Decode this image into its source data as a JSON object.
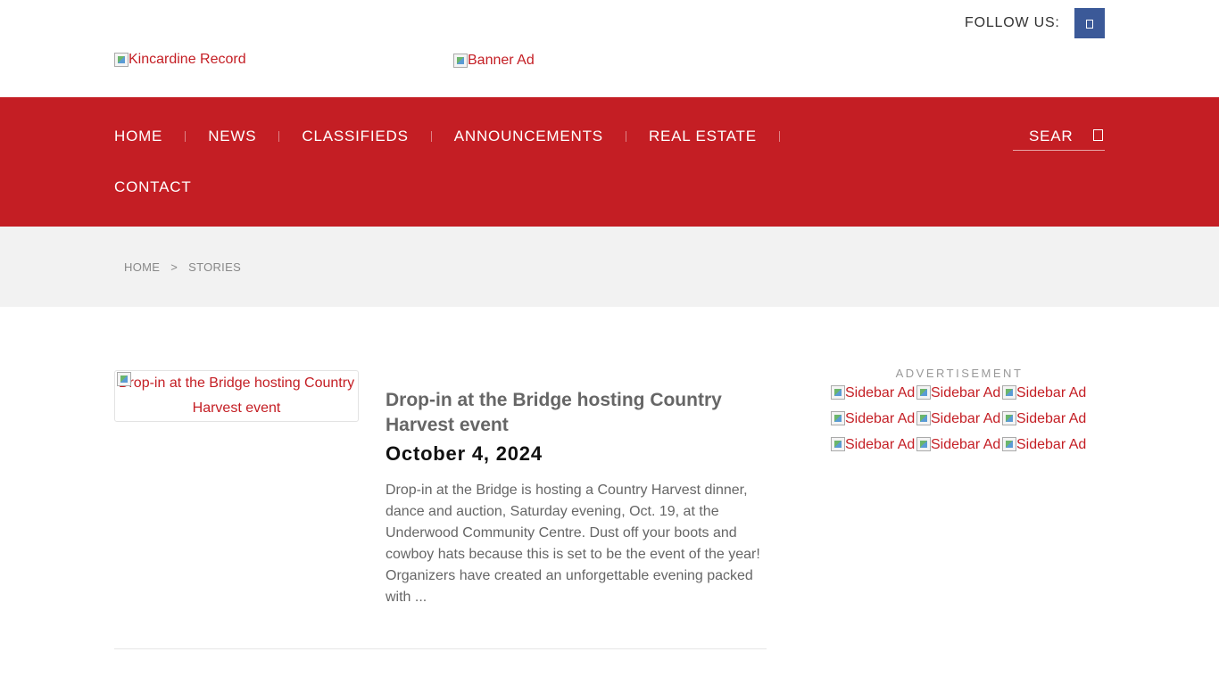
{
  "header": {
    "follow_label": "FOLLOW US:",
    "social_icon": "facebook-icon",
    "logo_alt": "Kincardine Record",
    "banner_alt": "Banner Ad"
  },
  "nav": {
    "row1": [
      "HOME",
      "NEWS",
      "CLASSIFIEDS",
      "ANNOUNCEMENTS",
      "REAL ESTATE"
    ],
    "row2": [
      "CONTACT"
    ],
    "search_label": "SEAR",
    "search_icon": "search-icon"
  },
  "breadcrumb": {
    "home": "HOME",
    "separator": ">",
    "current": "STORIES"
  },
  "story": {
    "thumb_alt": "Drop-in at the Bridge hosting Country Harvest event",
    "title": "Drop-in at the Bridge hosting Country Harvest event",
    "date": "October 4, 2024",
    "excerpt": "Drop-in at the Bridge is hosting a Country Harvest dinner, dance and auction, Saturday evening, Oct. 19, at the Underwood Community Centre. Dust off your boots and cowboy hats because this is set to be the event of the year! Organizers have created an unforgettable evening packed with ..."
  },
  "sidebar": {
    "ad_label": "ADVERTISEMENT",
    "ads": [
      [
        "Sidebar Ad",
        "Sidebar Ad",
        "Sidebar Ad"
      ],
      [
        "Sidebar Ad",
        "Sidebar Ad",
        "Sidebar Ad"
      ],
      [
        "Sidebar Ad",
        "Sidebar Ad",
        "Sidebar Ad"
      ]
    ]
  },
  "colors": {
    "brand_red": "#c41e24",
    "facebook_blue": "#3b5998",
    "breadcrumb_bg": "#f2f2f2"
  }
}
